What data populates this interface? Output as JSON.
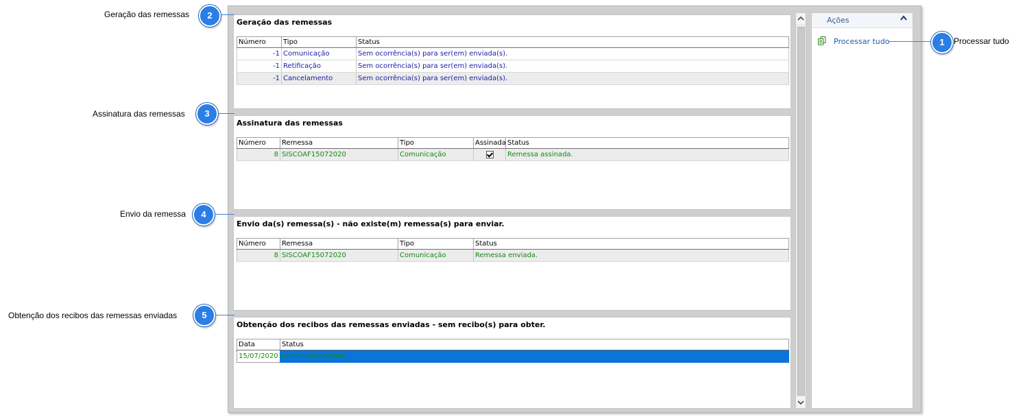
{
  "callouts": {
    "processar": {
      "label": "Processar tudo",
      "number": "1"
    },
    "geracao": {
      "label": "Geração das remessas",
      "number": "2"
    },
    "assinatura": {
      "label": "Assinatura das remessas",
      "number": "3"
    },
    "envio": {
      "label": "Envio da remessa",
      "number": "4"
    },
    "obtencao": {
      "label": "Obtenção dos recibos das remessas enviadas",
      "number": "5"
    }
  },
  "geracao": {
    "title": "Geração das remessas",
    "columns": [
      "Número",
      "Tipo",
      "Status"
    ],
    "rows": [
      {
        "numero": "-1",
        "tipo": "Comunicação",
        "status": "Sem ocorrência(s) para ser(em) enviada(s)."
      },
      {
        "numero": "-1",
        "tipo": "Retificação",
        "status": "Sem ocorrência(s) para ser(em) enviada(s)."
      },
      {
        "numero": "-1",
        "tipo": "Cancelamento",
        "status": "Sem ocorrência(s) para ser(em) enviada(s)."
      }
    ]
  },
  "assinatura": {
    "title": "Assinatura das remessas",
    "columns": [
      "Número",
      "Remessa",
      "Tipo",
      "Assinada",
      "Status"
    ],
    "rows": [
      {
        "numero": "8",
        "remessa": "SISCOAF15072020",
        "tipo": "Comunicação",
        "assinada": true,
        "status": "Remessa assinada."
      }
    ]
  },
  "envio": {
    "title": "Envio da(s) remessa(s) - não existe(m) remessa(s) para enviar.",
    "columns": [
      "Número",
      "Remessa",
      "Tipo",
      "Status"
    ],
    "rows": [
      {
        "numero": "8",
        "remessa": "SISCOAF15072020",
        "tipo": "Comunicação",
        "status": "Remessa enviada."
      }
    ]
  },
  "obtencao": {
    "title": "Obtenção dos recibos das remessas enviadas - sem recibo(s) para obter.",
    "columns": [
      "Data",
      "Status"
    ],
    "rows": [
      {
        "data": "15/07/2020",
        "status": "Recibo processado."
      }
    ]
  },
  "actions_panel": {
    "title": "Ações",
    "collapse_icon": "chevron-up-icon",
    "link_icon": "copy-pages-icon",
    "link_label": "Processar tudo"
  },
  "scrollbar": {
    "up_icon": "chevron-up-icon",
    "down_icon": "chevron-down-icon"
  },
  "colors": {
    "badge": "#2a7ee6",
    "link": "#1d5da8",
    "status_blue": "#1a1aa6",
    "status_green": "#138a13",
    "selection": "#0a74d9"
  }
}
